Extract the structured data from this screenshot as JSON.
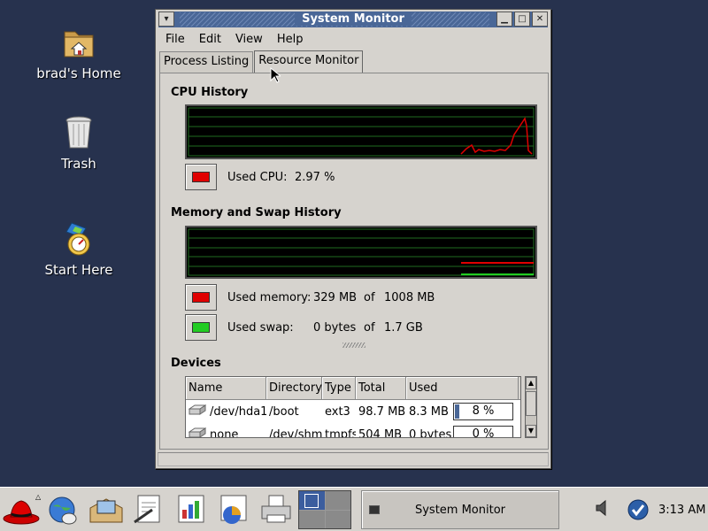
{
  "desktop": {
    "icons": [
      {
        "label": "brad's Home",
        "icon": "home-folder-icon"
      },
      {
        "label": "Trash",
        "icon": "trash-icon"
      },
      {
        "label": "Start Here",
        "icon": "start-here-icon"
      }
    ]
  },
  "window": {
    "title": "System Monitor",
    "menu": [
      "File",
      "Edit",
      "View",
      "Help"
    ],
    "tabs": [
      "Process Listing",
      "Resource Monitor"
    ],
    "active_tab": "Resource Monitor"
  },
  "cpu": {
    "section_title": "CPU History",
    "used_label": "Used CPU:",
    "used_value": "2.97 %",
    "color": "#e00000"
  },
  "memory": {
    "section_title": "Memory and Swap History",
    "mem_label": "Used memory:",
    "mem_used": "329 MB",
    "mem_of": "of",
    "mem_total": "1008 MB",
    "mem_color": "#e00000",
    "swap_label": "Used swap:",
    "swap_used": "0 bytes",
    "swap_of": "of",
    "swap_total": "1.7 GB",
    "swap_color": "#22cc22"
  },
  "devices": {
    "section_title": "Devices",
    "columns": [
      "Name",
      "Directory",
      "Type",
      "Total",
      "Used"
    ],
    "rows": [
      {
        "name": "/dev/hda1",
        "directory": "/boot",
        "type": "ext3",
        "total": "98.7 MB",
        "used": "8.3 MB",
        "percent_label": "8 %",
        "percent": 8
      },
      {
        "name": "none",
        "directory": "/dev/shm",
        "type": "tmpfs",
        "total": "504 MB",
        "used": "0 bytes",
        "percent_label": "0 %",
        "percent": 0
      }
    ]
  },
  "taskbar": {
    "task_label": "System Monitor",
    "clock": "3:13 AM"
  }
}
